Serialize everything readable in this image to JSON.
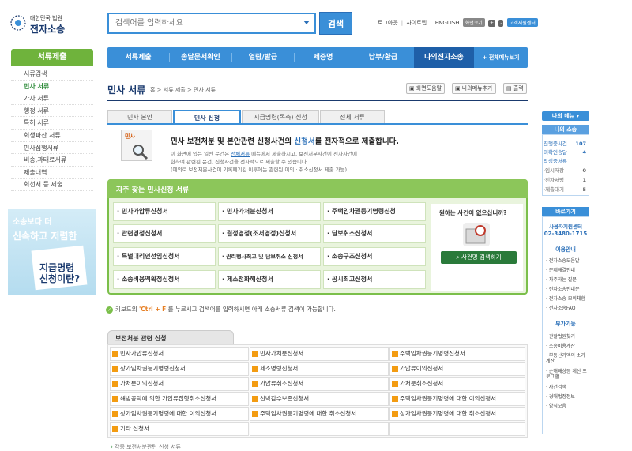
{
  "header": {
    "logo_top": "대한민국 법원",
    "logo_main": "전자소송",
    "search_placeholder": "검색어를 입력하세요",
    "search_button": "검색",
    "util_logout": "로그아웃",
    "util_sitemap": "사이트맵",
    "util_english": "ENGLISH",
    "font_label": "화면크기",
    "font_plus": "+",
    "font_minus": "-",
    "help": "고객지원센터"
  },
  "nav": {
    "items": [
      "서류제출",
      "송달문서확인",
      "열람/발급",
      "제증명",
      "납부/환급",
      "나의전자소송",
      "+ 전체메뉴보기"
    ]
  },
  "sidebar": {
    "title": "서류제출",
    "items": [
      "서류검색",
      "민사 서류",
      "가사 서류",
      "행정 서류",
      "특허 서류",
      "회생파산 서류",
      "민사집행서류",
      "비송,과태료서류",
      "제출내역",
      "회선서 등 제출"
    ]
  },
  "promo": {
    "line1": "소송보다 더",
    "line2": "신속하고 저렴한",
    "line3": "지급명령",
    "line4": "신청이란?"
  },
  "page": {
    "title": "민사 서류",
    "breadcrumb": "홈 > 서류 제출 > 민사 서류",
    "btn_help": "화면도움말",
    "btn_mymenu": "나의메뉴추가",
    "btn_print": "출력"
  },
  "tabs": [
    "민사 본안",
    "민사 신청",
    "지급명령(독촉) 신청",
    "전체 서류"
  ],
  "intro": {
    "icon_label": "민사",
    "title_pre": "민사 보전처분 및 본안관련 신청사건의 ",
    "title_hl": "신청서",
    "title_post": "를 전자적으로 제출합니다.",
    "desc1_pre": "이 화면에 있는 일반 문건은 ",
    "desc1_hl": "전체서류",
    "desc1_post": " 메뉴에서 제출하시고, 보전처분사건이 전자사건에",
    "desc2": "한하여 관련된 문건, 신청사건을 전자적으로 제출할 수 있습니다.",
    "desc3": "(예외로 보전처분사건이 기록폐기된 이후에는 관련된 이의 · 취소신청서 제출 가능)"
  },
  "green": {
    "title": "자주 찾는 민사신청 서류",
    "cells": [
      [
        "민사가압류신청서",
        "민사가처분신청서",
        "주택임차권등기명령신청"
      ],
      [
        "관련경정신청서",
        "결정경정(조서경정)신청서",
        "담보취소신청서"
      ],
      [
        "특별대리인선임신청서",
        "권리행사최고 및 담보취소 신청서",
        "소송구조신청서"
      ],
      [
        "소송비용액확정신청서",
        "제소전화해신청서",
        "공시최고신청서"
      ]
    ],
    "right_q": "원하는 사건이 없으십니까?",
    "right_btn": "사건명 검색하기"
  },
  "kbtip": {
    "pre": "키보드의 ",
    "key": "'Ctrl + F'",
    "post": "를 누르시고 검색어를 입력하시면 아래 소송서류 검색이 가능합니다."
  },
  "table": {
    "tab": "보전처분 관련 신청",
    "rows": [
      [
        "민사가압류신청서",
        "민사가처분신청서",
        "주택임차권등기명령신청서"
      ],
      [
        "상가임차권등기명령신청서",
        "제소명령신청서",
        "가압류이의신청서"
      ],
      [
        "가처분이의신청서",
        "가압류취소신청서",
        "가처분취소신청서"
      ],
      [
        "해방공탁에 의한 가압류집행취소신청서",
        "선박감수보존신청서",
        "주택임차권등기명령에 대한 이의신청서"
      ],
      [
        "상가임차권등기명령에 대한 이의신청서",
        "주택임차권등기명령에 대한 취소신청서",
        "상가임차권등기명령에 대한 취소신청서"
      ],
      [
        "기타 신청서",
        "",
        ""
      ]
    ],
    "more": "각종 보전처분관련 신청 서류"
  },
  "right": {
    "mymenu": "나의 메뉴",
    "mycase": "나의 소송",
    "rows": [
      {
        "label": "진행중사건",
        "count": "107"
      },
      {
        "label": "미확인송달",
        "count": "4"
      },
      {
        "label": "작성중서류",
        "count": ""
      },
      {
        "label": "·임시저장",
        "count": "0"
      },
      {
        "label": "·전자서명",
        "count": "1"
      },
      {
        "label": "·제출대기",
        "count": "5"
      }
    ],
    "shortcut": "바로가기",
    "center_name": "사용자지원센터",
    "center_phone": "02-3480-1715",
    "sec1": "이용안내",
    "links1": [
      "전자소송도움말",
      "문제해결안내",
      "자주하는 질문",
      "전자소송안내문",
      "전자소송 모의체험",
      "전자소송FAQ"
    ],
    "sec2": "부가기능",
    "links2": [
      "관할법원찾기",
      "소송비용계산",
      "부동산가액의 소가계산",
      "손해배상등 계산 프로그램",
      "사건검색",
      "경매법정정보",
      "양식모음"
    ]
  }
}
